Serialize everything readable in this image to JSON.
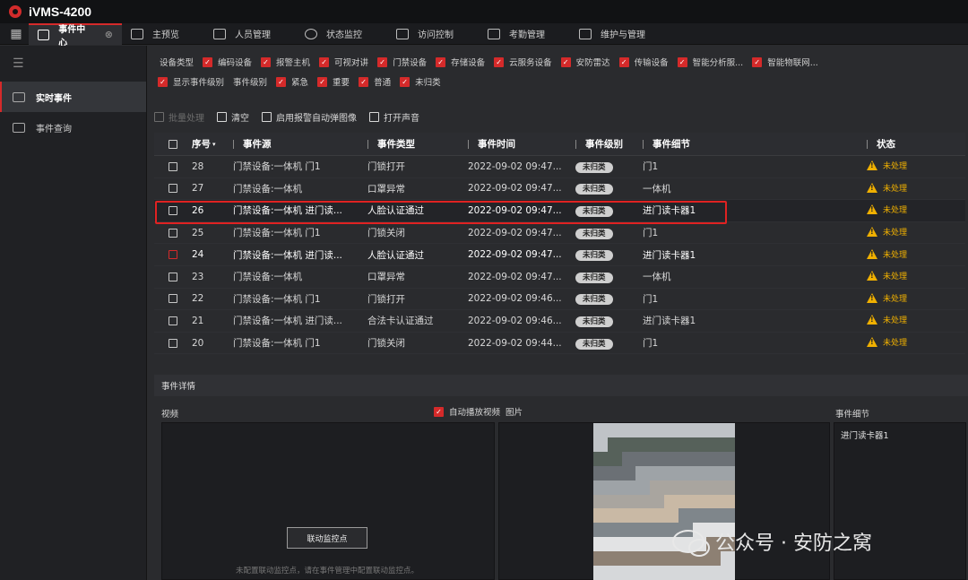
{
  "app": {
    "title": "iVMS-4200"
  },
  "tabs": [
    {
      "label": "事件中心",
      "active": true
    },
    {
      "label": "主预览"
    },
    {
      "label": "人员管理"
    },
    {
      "label": "状态监控"
    },
    {
      "label": "访问控制"
    },
    {
      "label": "考勤管理"
    },
    {
      "label": "维护与管理"
    }
  ],
  "sidebar": {
    "items": [
      {
        "label": "实时事件",
        "active": true
      },
      {
        "label": "事件查询"
      }
    ]
  },
  "filters": {
    "device_type_label": "设备类型",
    "device_types": [
      "编码设备",
      "报警主机",
      "可视对讲",
      "门禁设备",
      "存储设备",
      "云服务设备",
      "安防雷达",
      "传输设备",
      "智能分析服...",
      "智能物联网..."
    ],
    "show_level_label": "显示事件级别",
    "level_label": "事件级别",
    "levels": [
      "紧急",
      "重要",
      "普通",
      "未归类"
    ]
  },
  "toolbar": {
    "batch": "批量处理",
    "clear": "清空",
    "enable_popup": "启用报警自动弹图像",
    "sound": "打开声音"
  },
  "table": {
    "headers": {
      "seq": "序号",
      "source": "事件源",
      "type": "事件类型",
      "time": "事件时间",
      "level": "事件级别",
      "detail": "事件细节",
      "status": "状态"
    },
    "rows": [
      {
        "seq": "28",
        "source": "门禁设备:一体机 门1",
        "type": "门锁打开",
        "time": "2022-09-02 09:47...",
        "level": "未归类",
        "detail": "门1",
        "status": "未处理"
      },
      {
        "seq": "27",
        "source": "门禁设备:一体机",
        "type": "口罩异常",
        "time": "2022-09-02 09:47...",
        "level": "未归类",
        "detail": "一体机",
        "status": "未处理"
      },
      {
        "seq": "26",
        "source": "门禁设备:一体机 进门读...",
        "type": "人脸认证通过",
        "time": "2022-09-02 09:47...",
        "level": "未归类",
        "detail": "进门读卡器1",
        "status": "未处理"
      },
      {
        "seq": "25",
        "source": "门禁设备:一体机 门1",
        "type": "门锁关闭",
        "time": "2022-09-02 09:47...",
        "level": "未归类",
        "detail": "门1",
        "status": "未处理"
      },
      {
        "seq": "24",
        "source": "门禁设备:一体机 进门读...",
        "type": "人脸认证通过",
        "time": "2022-09-02 09:47...",
        "level": "未归类",
        "detail": "进门读卡器1",
        "status": "未处理"
      },
      {
        "seq": "23",
        "source": "门禁设备:一体机",
        "type": "口罩异常",
        "time": "2022-09-02 09:47...",
        "level": "未归类",
        "detail": "一体机",
        "status": "未处理"
      },
      {
        "seq": "22",
        "source": "门禁设备:一体机 门1",
        "type": "门锁打开",
        "time": "2022-09-02 09:46...",
        "level": "未归类",
        "detail": "门1",
        "status": "未处理"
      },
      {
        "seq": "21",
        "source": "门禁设备:一体机 进门读...",
        "type": "合法卡认证通过",
        "time": "2022-09-02 09:46...",
        "level": "未归类",
        "detail": "进门读卡器1",
        "status": "未处理"
      },
      {
        "seq": "20",
        "source": "门禁设备:一体机 门1",
        "type": "门锁关闭",
        "time": "2022-09-02 09:44...",
        "level": "未归类",
        "detail": "门1",
        "status": "未处理"
      }
    ]
  },
  "details": {
    "title": "事件详情",
    "video_label": "视频",
    "auto_play": "自动播放视频",
    "picture_label": "图片",
    "event_detail_label": "事件细节",
    "event_detail_value": "进门读卡器1",
    "link_button": "联动监控点",
    "no_link_note": "未配置联动监控点，请在事件管理中配置联动监控点。"
  },
  "watermark": {
    "text": "公众号 · 安防之窝"
  },
  "colors": {
    "accent": "#d52a2a",
    "warning": "#f0b000",
    "background": "#2a2b2e"
  }
}
